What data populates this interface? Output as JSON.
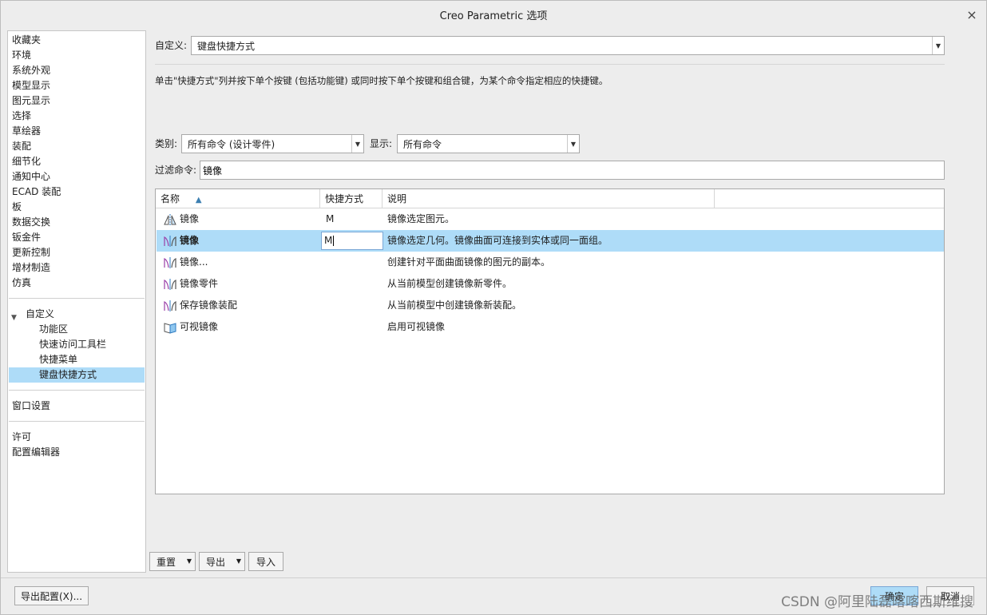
{
  "window": {
    "title": "Creo Parametric 选项",
    "close_glyph": "×"
  },
  "sidebar": {
    "items": [
      {
        "label": "收藏夹"
      },
      {
        "label": "环境"
      },
      {
        "label": "系统外观"
      },
      {
        "label": "模型显示"
      },
      {
        "label": "图元显示"
      },
      {
        "label": "选择"
      },
      {
        "label": "草绘器"
      },
      {
        "label": "装配"
      },
      {
        "label": "细节化"
      },
      {
        "label": "通知中心"
      },
      {
        "label": "ECAD 装配"
      },
      {
        "label": "板"
      },
      {
        "label": "数据交换"
      },
      {
        "label": "钣金件"
      },
      {
        "label": "更新控制"
      },
      {
        "label": "增材制造"
      },
      {
        "label": "仿真"
      }
    ],
    "customize": {
      "label": "自定义",
      "toggle_glyph": "▼",
      "children": [
        {
          "label": "功能区"
        },
        {
          "label": "快速访问工具栏"
        },
        {
          "label": "快捷菜单"
        },
        {
          "label": "键盘快捷方式"
        }
      ],
      "selected": "键盘快捷方式"
    },
    "window_settings": "窗口设置",
    "license": "许可",
    "config_editor": "配置编辑器"
  },
  "main": {
    "customize_label": "自定义:",
    "customize_value": "键盘快捷方式",
    "description": "单击\"快捷方式\"列并按下单个按键 (包括功能键) 或同时按下单个按键和组合键，为某个命令指定相应的快捷键。",
    "category_label": "类别:",
    "category_value": "所有命令 (设计零件)",
    "display_label": "显示:",
    "display_value": "所有命令",
    "filter_label": "过滤命令:",
    "filter_value": "镜像"
  },
  "table": {
    "columns": [
      "名称",
      "快捷方式",
      "说明"
    ],
    "sort_glyph": "▲",
    "rows": [
      {
        "name": "镜像",
        "shortcut": "M",
        "description": "镜像选定图元。",
        "icon": "mirror-entity-icon"
      },
      {
        "name": "镜像",
        "shortcut": "M",
        "description": "镜像选定几何。镜像曲面可连接到实体或同一面组。",
        "icon": "mirror-geometry-icon"
      },
      {
        "name": "镜像...",
        "shortcut": "",
        "description": "创建针对平面曲面镜像的图元的副本。",
        "icon": "mirror-geometry-icon"
      },
      {
        "name": "镜像零件",
        "shortcut": "",
        "description": "从当前模型创建镜像新零件。",
        "icon": "mirror-geometry-icon"
      },
      {
        "name": "保存镜像装配",
        "shortcut": "",
        "description": "从当前模型中创建镜像新装配。",
        "icon": "mirror-geometry-icon"
      },
      {
        "name": "可视镜像",
        "shortcut": "",
        "description": "启用可视镜像",
        "icon": "visible-mirror-icon"
      }
    ],
    "selected_row": 1
  },
  "buttons": {
    "reset": "重置",
    "export": "导出",
    "import": "导入",
    "export_config": "导出配置(X)...",
    "ok": "确定",
    "cancel": "取消",
    "dropdown_glyph": "▼"
  },
  "watermark": "CSDN @阿里陆磊喀喀西斯维搜"
}
